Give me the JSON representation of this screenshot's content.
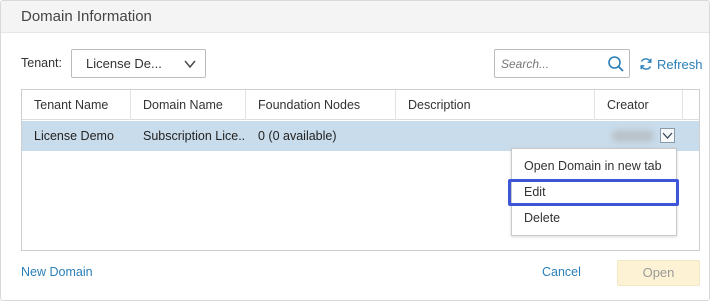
{
  "dialog": {
    "title": "Domain Information"
  },
  "toolbar": {
    "tenant_label": "Tenant:",
    "tenant_value": "License De...",
    "search_placeholder": "Search...",
    "refresh_label": "Refresh"
  },
  "table": {
    "columns": [
      "Tenant Name",
      "Domain Name",
      "Foundation Nodes",
      "Description",
      "Creator"
    ],
    "rows": [
      {
        "tenant_name": "License Demo",
        "domain_name": "Subscription Lice...",
        "foundation_nodes": "0 (0 available)",
        "description": "",
        "creator": ""
      }
    ]
  },
  "context_menu": {
    "items": [
      "Open Domain in new tab",
      "Edit",
      "Delete"
    ],
    "highlighted": "Edit"
  },
  "footer": {
    "new_domain_label": "New Domain",
    "cancel_label": "Cancel",
    "open_label": "Open"
  },
  "colors": {
    "link": "#2a7fb8",
    "selected_row": "#c9dceb",
    "highlight_outline": "#3c55d9",
    "open_button_bg": "#fdf3d4"
  },
  "icons": {
    "tenant_dropdown": "chevron-down-icon",
    "search": "search-icon",
    "refresh": "refresh-icon",
    "row_menu": "chevron-down-icon"
  }
}
